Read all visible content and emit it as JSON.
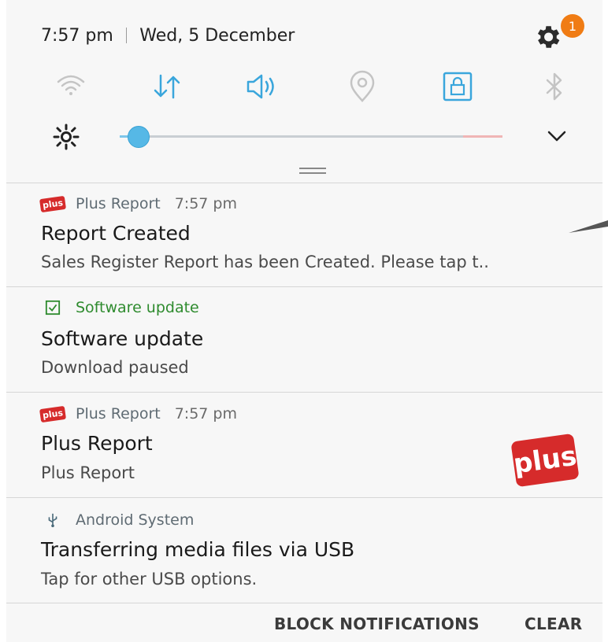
{
  "status_bar": {
    "time": "7:57 pm",
    "date": "Wed, 5 December",
    "settings_badge": "1"
  },
  "quick_settings": {
    "icons": [
      "wifi-icon",
      "mobile-data-icon",
      "sound-icon",
      "location-icon",
      "screen-lock-icon",
      "bluetooth-icon"
    ],
    "brightness_level": 0.05,
    "accent_color": "#3aa6dc"
  },
  "notifications": [
    {
      "app": "Plus Report",
      "time": "7:57 pm",
      "title": "Report Created",
      "text": "Sales Register Report has been Created. Please tap t.."
    },
    {
      "app": "Software update",
      "time": "",
      "title": "Software update",
      "text": "Download paused",
      "app_color": "#2e8b2e"
    },
    {
      "app": "Plus Report",
      "time": "7:57 pm",
      "title": "Plus Report",
      "text": "Plus Report",
      "large_icon": "plus"
    },
    {
      "app": "Android System",
      "time": "",
      "title": "Transferring media files via USB",
      "text": "Tap for other USB options."
    }
  ],
  "icon_labels": {
    "plus_small": "plus",
    "plus_big": "plus"
  },
  "footer": {
    "block_label": "BLOCK NOTIFICATIONS",
    "clear_label": "CLEAR"
  }
}
